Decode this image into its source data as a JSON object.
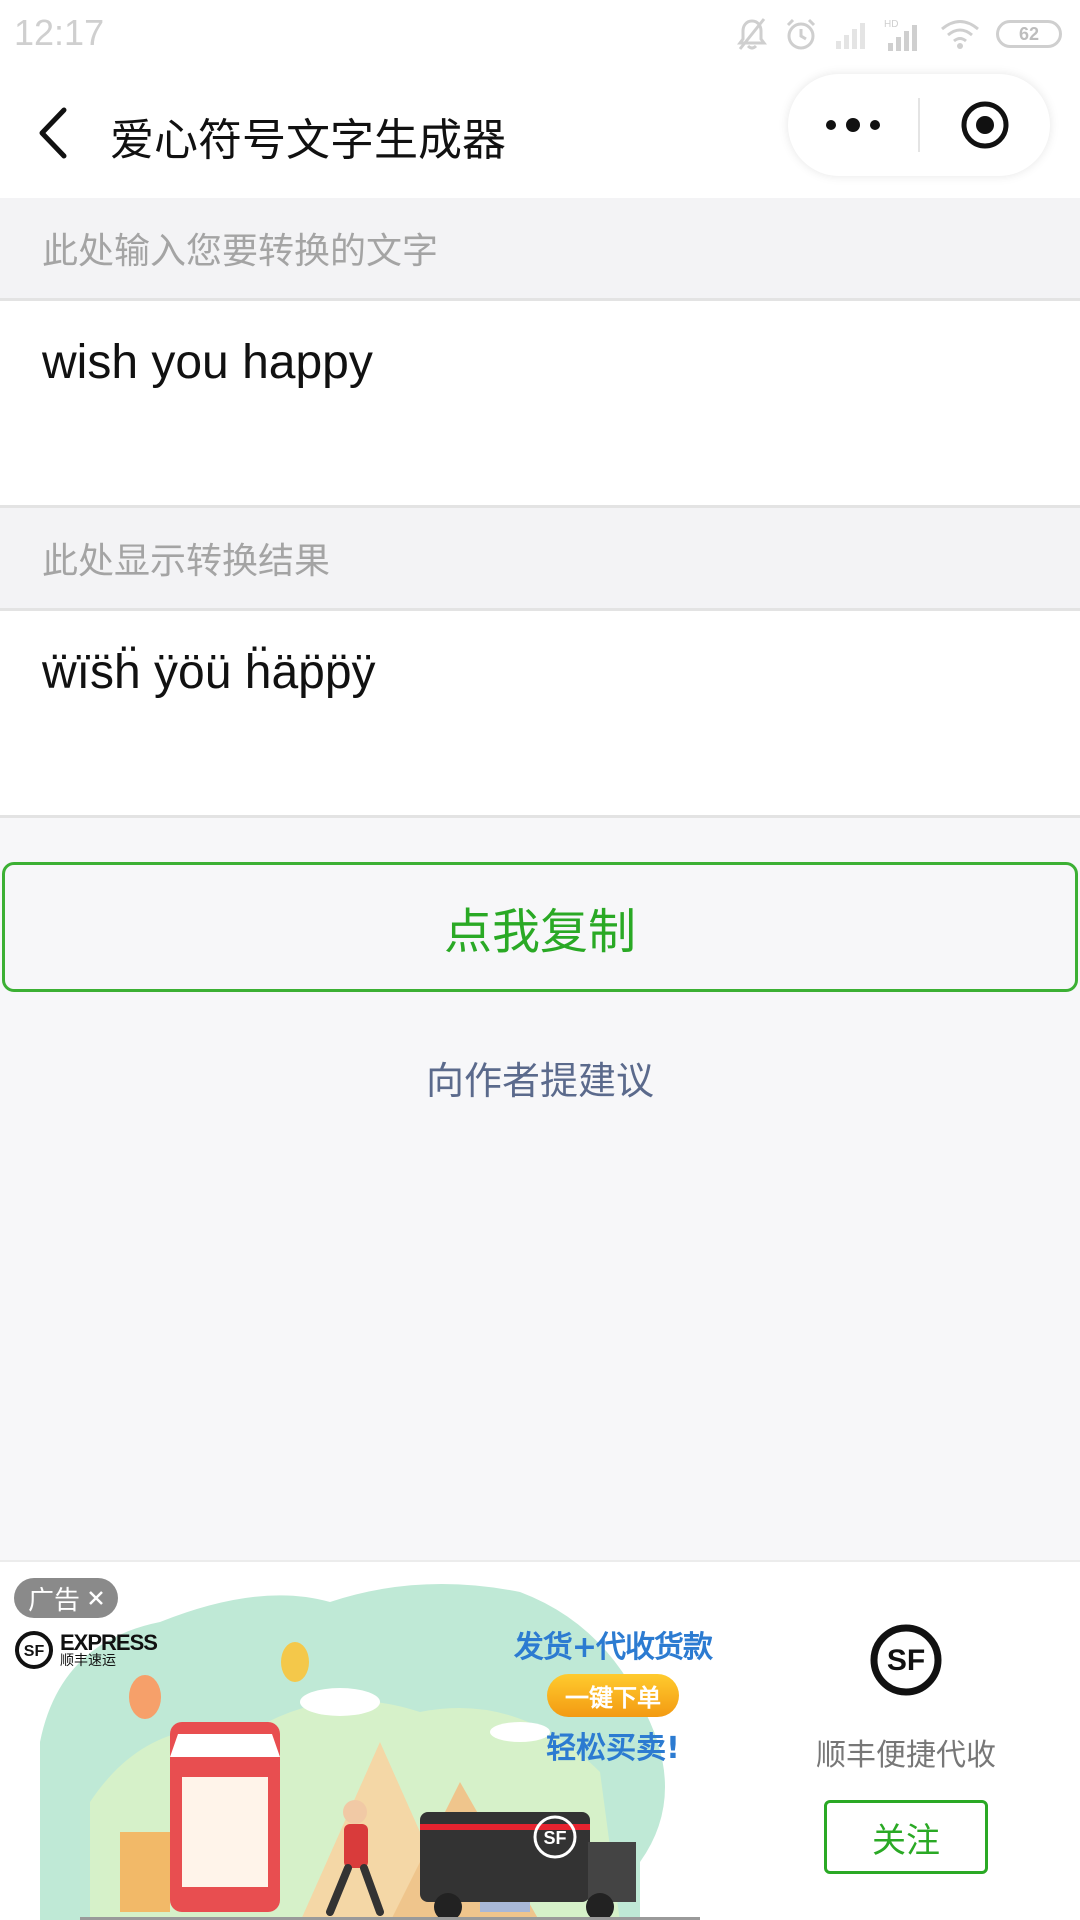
{
  "status_bar": {
    "time": "12:17",
    "battery": "62"
  },
  "nav": {
    "title": "爱心符号文字生成器"
  },
  "input_section": {
    "label": "此处输入您要转换的文字",
    "value": "wish you happy"
  },
  "result_section": {
    "label": "此处显示转换结果",
    "value": "ẅïs̈ḧ ÿöü ḧäp̈p̈ÿ"
  },
  "actions": {
    "copy_label": "点我复制",
    "suggest_label": "向作者提建议"
  },
  "ad": {
    "tag": "广告",
    "brand_en": "EXPRESS",
    "brand_cn": "顺丰速运",
    "slogan_line1": "发货+代收货款",
    "slogan_button": "一键下单",
    "slogan_line3": "轻松买卖!",
    "truck_logo": "SF",
    "advertiser_logo": "SF",
    "advertiser_name": "顺丰便捷代收",
    "follow_label": "关注"
  },
  "colors": {
    "accent_green": "#2aa925",
    "link_blue_gray": "#5b6a8c",
    "page_bg": "#f7f7f9"
  }
}
